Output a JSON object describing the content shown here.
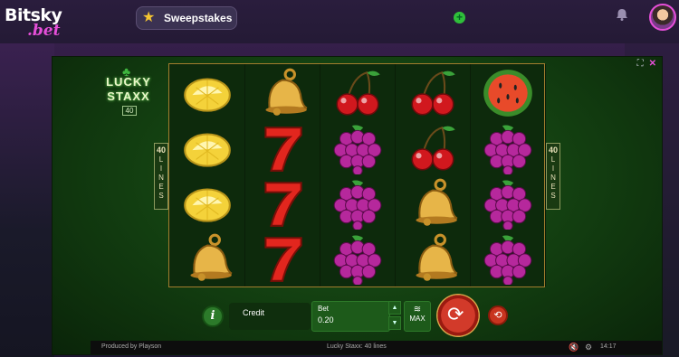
{
  "site": {
    "logo_top": "Bitsky",
    "logo_bottom": ".bet",
    "sweepstakes_label": "Sweepstakes",
    "brand_color": "#e64fd9"
  },
  "icons": {
    "star": "star-icon",
    "plus": "plus-icon",
    "bell": "bell-icon",
    "avatar": "avatar",
    "fullscreen": "fullscreen-icon",
    "close": "close-icon",
    "info": "info-icon",
    "sound": "sound-icon",
    "settings": "gear-icon"
  },
  "game": {
    "title_line1": "LUCKY",
    "title_line2": "STAXX",
    "title_num": "40",
    "lines_num": "40",
    "lines_word": "LINES",
    "reels": [
      [
        "lemon",
        "lemon",
        "lemon",
        "bell"
      ],
      [
        "bell",
        "seven",
        "seven",
        "seven"
      ],
      [
        "cherry",
        "grapes",
        "grapes",
        "grapes"
      ],
      [
        "cherry",
        "cherry",
        "bell",
        "bell"
      ],
      [
        "watermelon",
        "grapes",
        "grapes",
        "grapes"
      ]
    ],
    "credit_label": "Credit",
    "bet_label": "Bet",
    "bet_value": "0.20",
    "max_label": "MAX",
    "info_label": "i"
  },
  "footer": {
    "produced_by": "Produced by Playson",
    "center": "Lucky Staxx: 40 lines",
    "time": "14:17"
  }
}
